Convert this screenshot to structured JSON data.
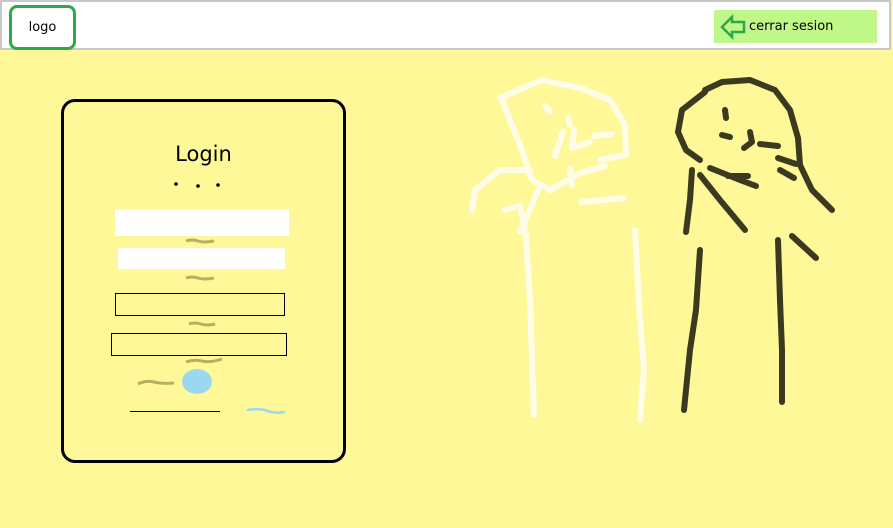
{
  "header": {
    "logo_label": "logo",
    "logout_label": "cerrar sesion",
    "logout_icon": "arrow-left-icon"
  },
  "login": {
    "title": "Login"
  },
  "colors": {
    "background": "#fff899",
    "logout_bg": "#bff788",
    "logo_border": "#2ea84a",
    "logout_arrow": "#2ea84a",
    "button_circle": "#9bd8f0",
    "figure_light": "#fffde8",
    "figure_dark": "#3b3a1f"
  }
}
